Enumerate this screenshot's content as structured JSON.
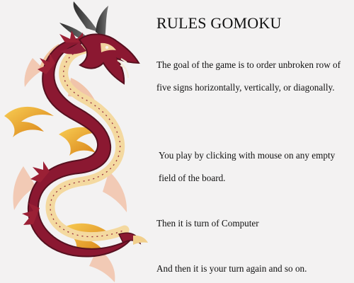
{
  "rules": {
    "title": "RULES GOMOKU",
    "paragraphs": [
      "The goal of the game is to order unbroken row of five signs horizontally, vertically, or diagonally.",
      "You play by clicking with mouse on any empty field of the board.",
      "Then it is turn of Computer",
      "And then it is your turn again and so on."
    ]
  },
  "decoration": {
    "image": "dragon-illustration",
    "colors": {
      "body": "#8b1831",
      "belly": "#f4d9a0",
      "flames": "#e6a52a",
      "horns": "#4c4c4c"
    }
  }
}
